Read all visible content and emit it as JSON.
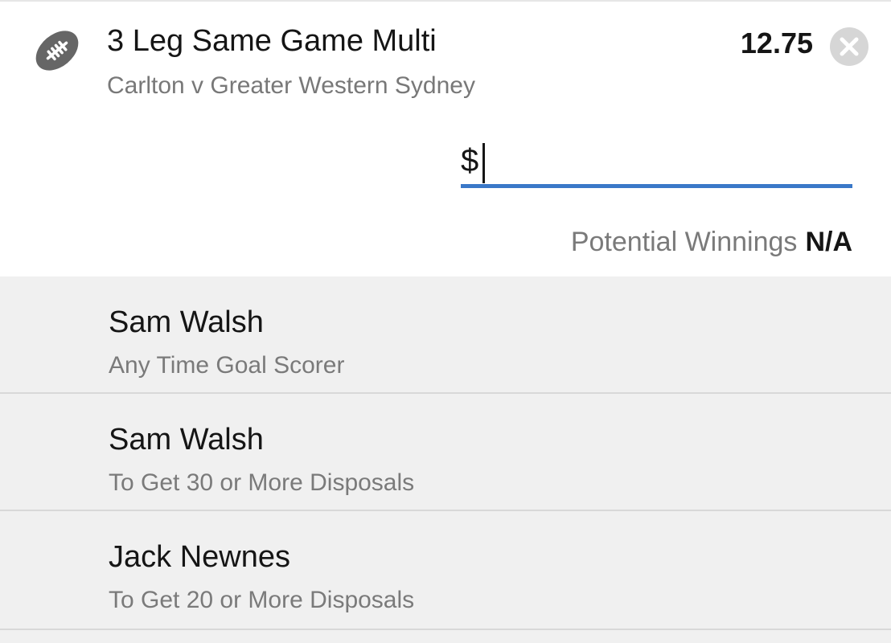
{
  "bet": {
    "title": "3 Leg Same Game Multi",
    "event": "Carlton v Greater Western Sydney",
    "odds": "12.75",
    "sport_icon": "football-icon",
    "close_icon": "close-icon"
  },
  "stake": {
    "prefix": "$",
    "value": ""
  },
  "winnings": {
    "label": "Potential Winnings",
    "value": "N/A"
  },
  "legs": [
    {
      "player": "Sam Walsh",
      "market": "Any Time Goal Scorer"
    },
    {
      "player": "Sam Walsh",
      "market": "To Get 30 or More Disposals"
    },
    {
      "player": "Jack Newnes",
      "market": "To Get 20 or More Disposals"
    }
  ],
  "colors": {
    "accent": "#3a78c8",
    "icon": "#666666",
    "close_bg": "#d6d6d6"
  }
}
